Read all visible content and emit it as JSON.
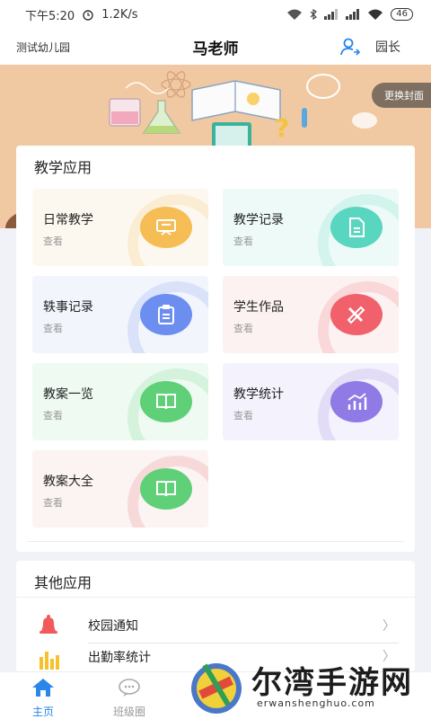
{
  "status_bar": {
    "time": "下午5:20",
    "speed": "1.2K/s",
    "battery": "46"
  },
  "header": {
    "school": "测试幼儿园",
    "title": "马老师",
    "role": "园长"
  },
  "banner": {
    "cover_button": "更换封面"
  },
  "teaching_apps": {
    "title": "教学应用",
    "items": [
      {
        "label": "日常教学",
        "sub": "查看",
        "icon": "blackboard-icon",
        "color": "#f6bd55"
      },
      {
        "label": "教学记录",
        "sub": "查看",
        "icon": "document-icon",
        "color": "#58d6c0"
      },
      {
        "label": "轶事记录",
        "sub": "查看",
        "icon": "clipboard-icon",
        "color": "#6c8ef0"
      },
      {
        "label": "学生作品",
        "sub": "查看",
        "icon": "pencil-ruler-icon",
        "color": "#f0616b"
      },
      {
        "label": "教案一览",
        "sub": "查看",
        "icon": "book-icon",
        "color": "#5fd078"
      },
      {
        "label": "教学统计",
        "sub": "查看",
        "icon": "chart-icon",
        "color": "#8f7ae6"
      },
      {
        "label": "教案大全",
        "sub": "查看",
        "icon": "book-icon",
        "color": "#5fd078"
      }
    ]
  },
  "other_apps": {
    "title": "其他应用",
    "items": [
      {
        "label": "校园通知",
        "icon": "bell-icon"
      },
      {
        "label": "出勤率统计",
        "icon": "bar-chart-icon"
      }
    ]
  },
  "tabbar": {
    "items": [
      {
        "label": "主页",
        "icon": "home-icon",
        "active": true
      },
      {
        "label": "班级圈",
        "icon": "chat-bubble-icon",
        "active": false
      }
    ]
  },
  "watermark": {
    "text": "尔湾手游网",
    "url": "erwanshenghuo.com"
  },
  "colors": {
    "accent": "#2a86e8",
    "banner": "#f0c9a2"
  }
}
